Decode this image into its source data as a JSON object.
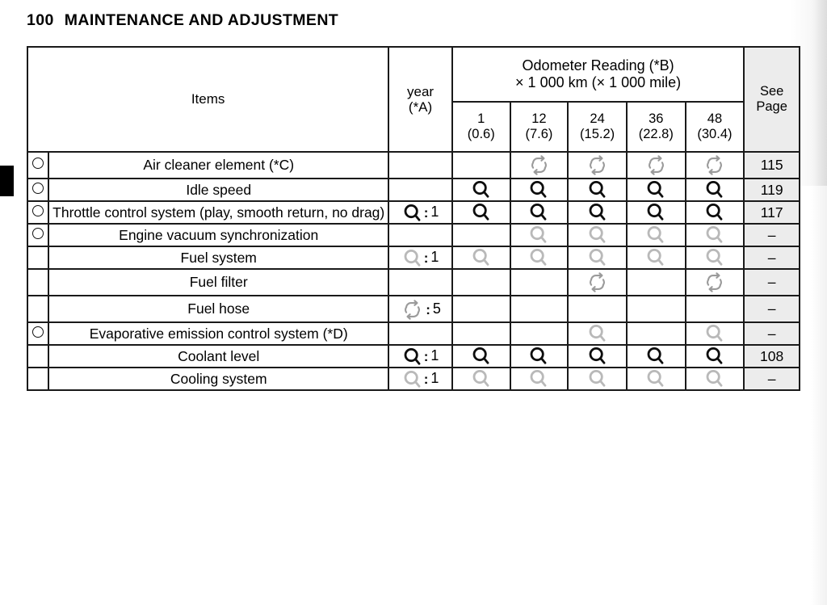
{
  "page": {
    "number": "100",
    "running_title": "MAINTENANCE AND ADJUSTMENT"
  },
  "table": {
    "headers": {
      "items": "Items",
      "year_line1": "year",
      "year_line2": "(*A)",
      "odometer_line1": "Odometer Reading (*B)",
      "odometer_line2": "× 1 000 km (× 1 000 mile)",
      "see_page_line1": "See",
      "see_page_line2": "Page",
      "odometer_columns": [
        {
          "km": "1",
          "mile": "(0.6)"
        },
        {
          "km": "12",
          "mile": "(7.6)"
        },
        {
          "km": "24",
          "mile": "(15.2)"
        },
        {
          "km": "36",
          "mile": "(22.8)"
        },
        {
          "km": "48",
          "mile": "(30.4)"
        }
      ]
    },
    "rows": [
      {
        "marker": true,
        "item": "Air cleaner element (*C)",
        "year_icon": "",
        "year_value": "",
        "cells": [
          "",
          "replace-faint",
          "replace-faint",
          "replace-faint",
          "replace-faint"
        ],
        "see_page": "115"
      },
      {
        "marker": true,
        "item": "Idle speed",
        "year_icon": "",
        "year_value": "",
        "cells": [
          "inspect-dark",
          "inspect-dark",
          "inspect-dark",
          "inspect-dark",
          "inspect-dark"
        ],
        "see_page": "119"
      },
      {
        "marker": true,
        "item": "Throttle control system (play, smooth return, no drag)",
        "year_icon": "inspect-dark",
        "year_value": "1",
        "cells": [
          "inspect-dark",
          "inspect-dark",
          "inspect-dark",
          "inspect-dark",
          "inspect-dark"
        ],
        "see_page": "117"
      },
      {
        "marker": true,
        "item": "Engine vacuum synchronization",
        "year_icon": "",
        "year_value": "",
        "cells": [
          "",
          "inspect-faint",
          "inspect-faint",
          "inspect-faint",
          "inspect-faint"
        ],
        "see_page": "–"
      },
      {
        "marker": false,
        "item": "Fuel system",
        "year_icon": "inspect-faint",
        "year_value": "1",
        "cells": [
          "inspect-faint",
          "inspect-faint",
          "inspect-faint",
          "inspect-faint",
          "inspect-faint"
        ],
        "see_page": "–"
      },
      {
        "marker": false,
        "item": "Fuel filter",
        "year_icon": "",
        "year_value": "",
        "cells": [
          "",
          "",
          "replace-faint",
          "",
          "replace-faint"
        ],
        "see_page": "–"
      },
      {
        "marker": false,
        "item": "Fuel hose",
        "year_icon": "replace-faint",
        "year_value": "5",
        "cells": [
          "",
          "",
          "",
          "",
          ""
        ],
        "see_page": "–"
      },
      {
        "marker": true,
        "item": "Evaporative emission control system (*D)",
        "year_icon": "",
        "year_value": "",
        "cells": [
          "",
          "",
          "inspect-faint",
          "",
          "inspect-faint"
        ],
        "see_page": "–"
      },
      {
        "marker": false,
        "item": "Coolant level",
        "year_icon": "inspect-dark",
        "year_value": "1",
        "cells": [
          "inspect-dark",
          "inspect-dark",
          "inspect-dark",
          "inspect-dark",
          "inspect-dark"
        ],
        "see_page": "108"
      },
      {
        "marker": false,
        "item": "Cooling system",
        "year_icon": "inspect-faint",
        "year_value": "1",
        "cells": [
          "inspect-faint",
          "inspect-faint",
          "inspect-faint",
          "inspect-faint",
          "inspect-faint"
        ],
        "see_page": "–"
      }
    ]
  },
  "icons": {
    "inspect": "magnifier-inspect-icon",
    "replace": "replace-arrows-icon",
    "marker": "emission-related-circle-icon"
  },
  "colors": {
    "ink": "#0d0d0d",
    "faint_ink": "#b9b9b9",
    "page_column_bg": "#ececec",
    "rule": "#1a1a1a"
  }
}
